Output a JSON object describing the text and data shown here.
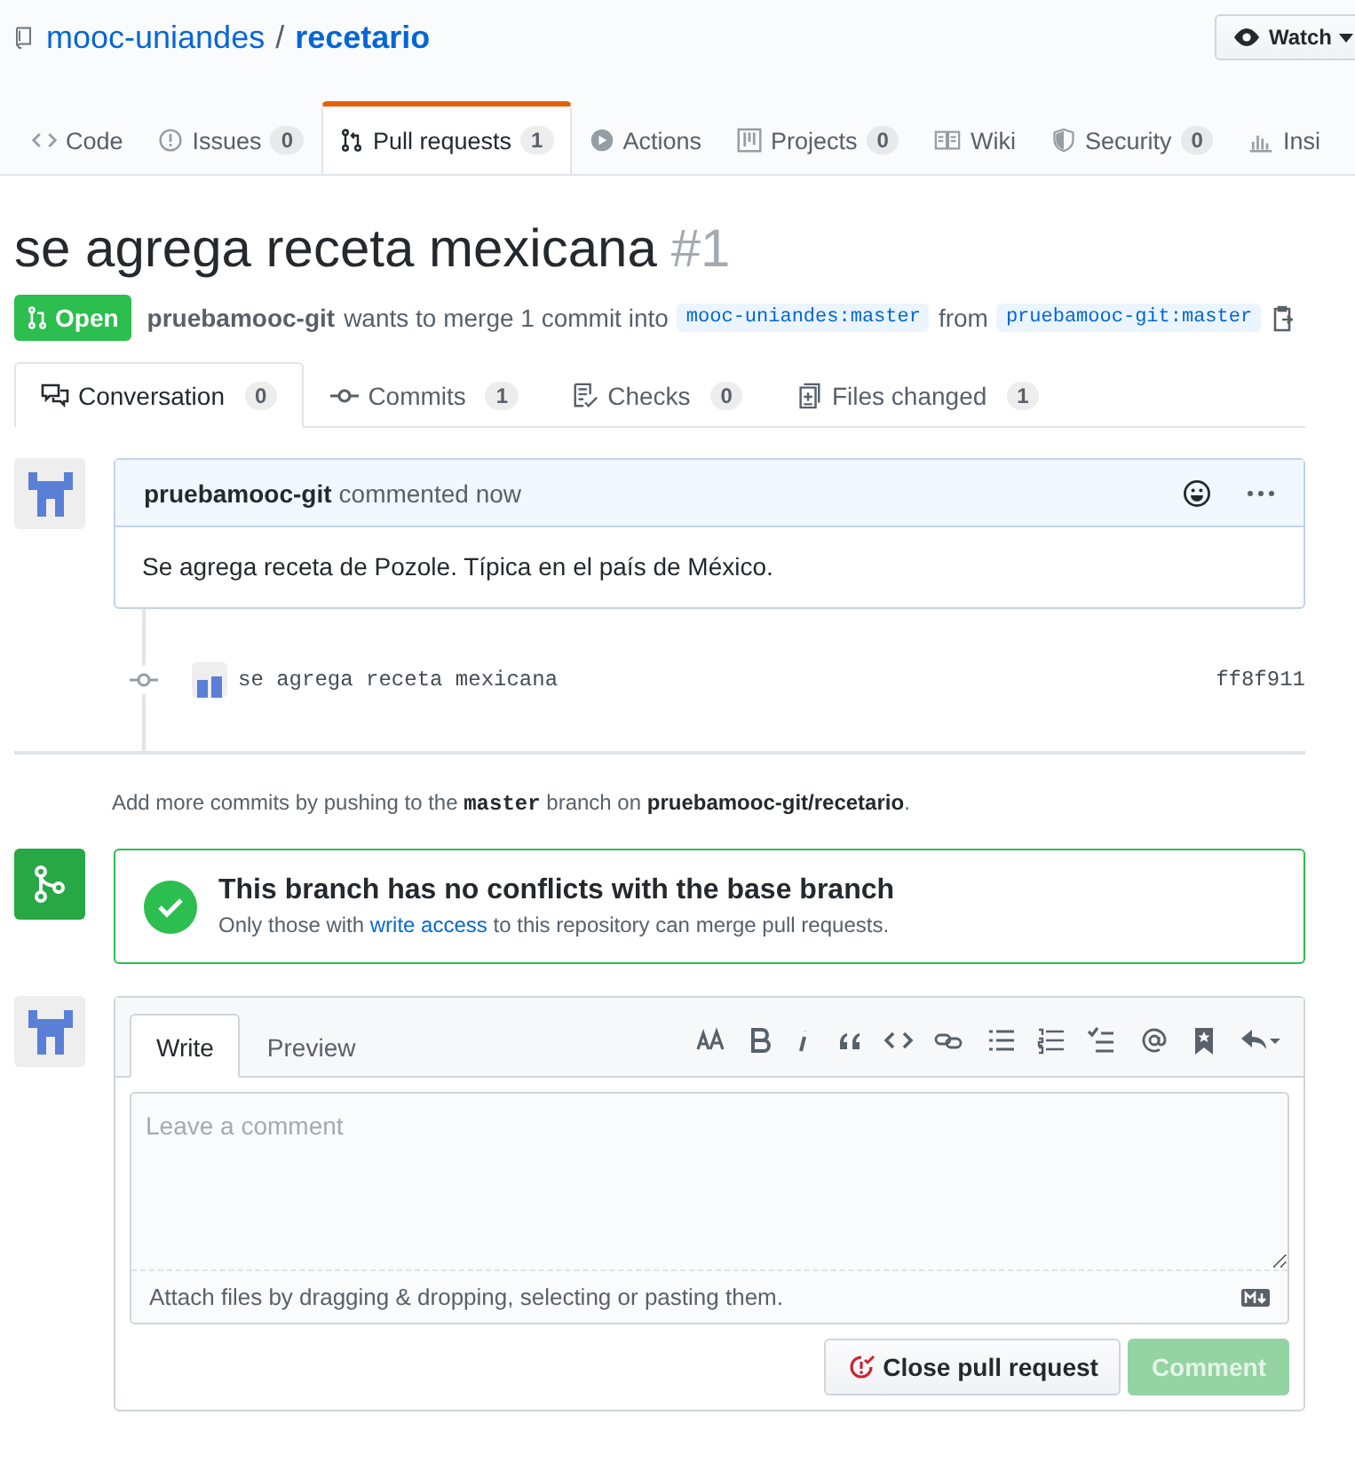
{
  "repo": {
    "owner": "mooc-uniandes",
    "separator": "/",
    "name": "recetario",
    "watch": "Watch"
  },
  "repo_tabs": [
    {
      "kind": "code",
      "label": "Code",
      "selected": false
    },
    {
      "kind": "issues",
      "label": "Issues",
      "count": "0",
      "selected": false
    },
    {
      "kind": "pulls",
      "label": "Pull requests",
      "count": "1",
      "selected": true
    },
    {
      "kind": "actions",
      "label": "Actions",
      "selected": false
    },
    {
      "kind": "projects",
      "label": "Projects",
      "count": "0",
      "selected": false
    },
    {
      "kind": "wiki",
      "label": "Wiki",
      "selected": false
    },
    {
      "kind": "security",
      "label": "Security",
      "count": "0",
      "selected": false
    },
    {
      "kind": "insights",
      "label": "Insi",
      "selected": false
    }
  ],
  "pull_request": {
    "title": "se agrega receta mexicana",
    "number": "#1",
    "open": true,
    "state_label": "Open",
    "author": "pruebamooc-git",
    "summary": "wants to merge 1 commit into",
    "base": "mooc-uniandes:master",
    "from": "from",
    "head": "pruebamooc-git:master"
  },
  "pr_tabs": [
    {
      "kind": "conversation",
      "label": "Conversation",
      "count": "0",
      "selected": true
    },
    {
      "kind": "commits",
      "label": "Commits",
      "count": "1",
      "selected": false
    },
    {
      "kind": "checks",
      "label": "Checks",
      "count": "0",
      "selected": false
    },
    {
      "kind": "files",
      "label": "Files changed",
      "count": "1",
      "selected": false
    }
  ],
  "comment": {
    "author": "pruebamooc-git",
    "meta": "commented now",
    "body": "Se agrega receta de Pozole. Típica en el país de México."
  },
  "commit": {
    "message": "se agrega receta mexicana",
    "sha": "ff8f911"
  },
  "push_hint": "Add more commits by pushing to the **master** branch on **pruebamooc-git/recetario**.",
  "merge_status": {
    "title": "This branch has no conflicts with the base branch",
    "before": "Only those with",
    "link": "write access",
    "after": "to this repository can merge pull requests."
  },
  "composer": {
    "tabs": [
      {
        "label": "Write",
        "selected": true
      },
      {
        "label": "Preview",
        "selected": false
      }
    ],
    "placeholder": "Leave a comment",
    "attach_hint": "Attach files by dragging & dropping, selecting or pasting them.",
    "close_button": "Close pull request",
    "comment_button": "Comment",
    "comment_disabled": true
  }
}
